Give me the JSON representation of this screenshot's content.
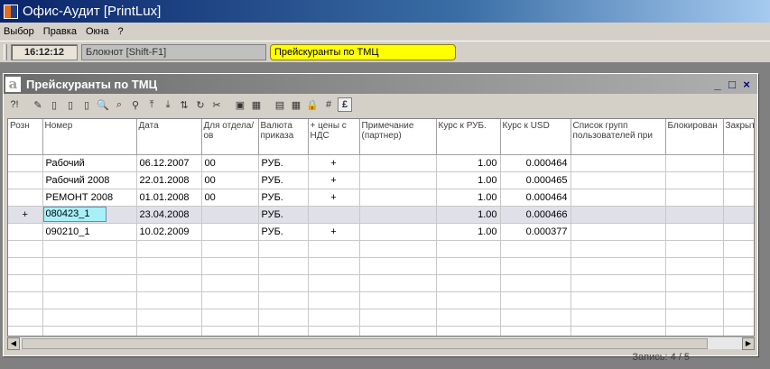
{
  "app": {
    "title": "Офис-Аудит [PrintLux]"
  },
  "menu": [
    "Выбор",
    "Правка",
    "Окна",
    "?"
  ],
  "taskbar": {
    "clock": "16:12:12",
    "tasks": [
      {
        "label": "Блокнот  [Shift-F1]",
        "active": false
      },
      {
        "label": "Прейскуранты по ТМЦ",
        "active": true
      }
    ]
  },
  "window": {
    "title": "Прейскуранты по ТМЦ",
    "logo": "a",
    "minimize": "_",
    "maximize": "□",
    "close": "×"
  },
  "toolbar": {
    "buttons": [
      {
        "icon": "help-icon",
        "glyph": "?!"
      },
      {
        "icon": "edit-icon",
        "glyph": "✎"
      },
      {
        "icon": "new-doc-icon",
        "glyph": "▯"
      },
      {
        "icon": "copy-doc-icon",
        "glyph": "▯"
      },
      {
        "icon": "delete-doc-icon",
        "glyph": "▯"
      },
      {
        "icon": "search-icon",
        "glyph": "🔍"
      },
      {
        "icon": "find-next-icon",
        "glyph": "⌕"
      },
      {
        "icon": "filter-icon",
        "glyph": "⚲"
      },
      {
        "icon": "sort-up-icon",
        "glyph": "⤒"
      },
      {
        "icon": "sort-down-icon",
        "glyph": "⤓"
      },
      {
        "icon": "sort-az-icon",
        "glyph": "⇅"
      },
      {
        "icon": "refresh-icon",
        "glyph": "↻"
      },
      {
        "icon": "cut-icon",
        "glyph": "✂"
      },
      {
        "icon": "view-icon",
        "glyph": "▣"
      },
      {
        "icon": "excel-icon",
        "glyph": "▦"
      },
      {
        "icon": "report-icon",
        "glyph": "▤"
      },
      {
        "icon": "calculator-icon",
        "glyph": "▦"
      },
      {
        "icon": "lock-icon",
        "glyph": "🔒"
      },
      {
        "icon": "grid-icon",
        "glyph": "#"
      },
      {
        "icon": "pound-icon",
        "glyph": "£"
      }
    ]
  },
  "grid": {
    "columns": [
      "Розн",
      "Номер",
      "Дата",
      "Для отдела/ов",
      "Валюта приказа",
      "+ цены с НДС",
      "Примечание (партнер)",
      "Курс к РУБ.",
      "Курс к USD",
      "Список групп пользователей при",
      "Блокирован",
      "Закрыт"
    ],
    "rows": [
      [
        "",
        "Рабочий",
        "06.12.2007",
        "00",
        "РУБ.",
        "+",
        "",
        "1.00",
        "0.000464",
        "",
        "",
        ""
      ],
      [
        "",
        "Рабочий 2008",
        "22.01.2008",
        "00",
        "РУБ.",
        "+",
        "",
        "1.00",
        "0.000465",
        "",
        "",
        ""
      ],
      [
        "",
        "РЕМОНТ 2008",
        "01.01.2008",
        "00",
        "РУБ.",
        "+",
        "",
        "1.00",
        "0.000464",
        "",
        "",
        ""
      ],
      [
        "+",
        "080423_1",
        "23.04.2008",
        "",
        "РУБ.",
        "",
        "",
        "1.00",
        "0.000466",
        "",
        "",
        ""
      ],
      [
        "",
        "090210_1",
        "10.02.2009",
        "",
        "РУБ.",
        "+",
        "",
        "1.00",
        "0.000377",
        "",
        "",
        ""
      ]
    ],
    "selected_row": 3,
    "empty_rows": 6
  },
  "status": {
    "record": "Запись: 4 / 5"
  }
}
